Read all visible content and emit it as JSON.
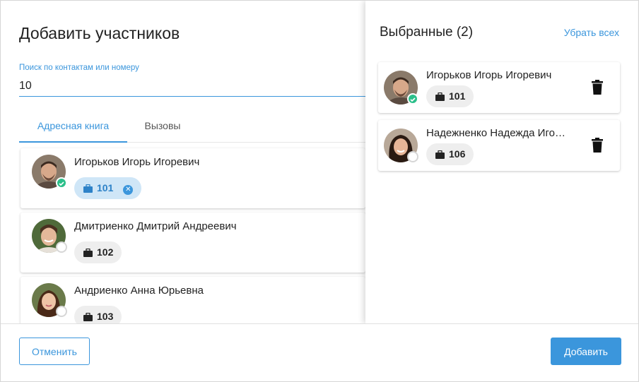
{
  "dialog": {
    "title": "Добавить участников",
    "search": {
      "label": "Поиск по контактам или номеру",
      "value": "10"
    },
    "tabs": [
      {
        "label": "Адресная книга",
        "active": true
      },
      {
        "label": "Вызовы",
        "active": false
      }
    ]
  },
  "contacts": [
    {
      "name": "Игорьков Игорь Игоревич",
      "ext": "101",
      "status": "online",
      "selected": true,
      "avatar_icon": "male-avatar-icon"
    },
    {
      "name": "Дмитриенко Дмитрий Андреевич",
      "ext": "102",
      "status": "offline",
      "selected": false,
      "avatar_icon": "male-avatar-icon"
    },
    {
      "name": "Андриенко Анна Юрьевна",
      "ext": "103",
      "status": "offline",
      "selected": false,
      "avatar_icon": "female-avatar-icon"
    }
  ],
  "selected_panel": {
    "title": "Выбранные (2)",
    "clear_all": "Убрать всех",
    "items": [
      {
        "name": "Игорьков Игорь Игоревич",
        "ext": "101",
        "status": "online"
      },
      {
        "name": "Надежненко Надежда Игоревна",
        "ext": "106",
        "status": "offline"
      }
    ]
  },
  "footer": {
    "cancel_label": "Отменить",
    "add_label": "Добавить"
  },
  "colors": {
    "accent": "#3b96dc",
    "online": "#2bbf8a",
    "chip_selected": "#cfe6f7"
  }
}
